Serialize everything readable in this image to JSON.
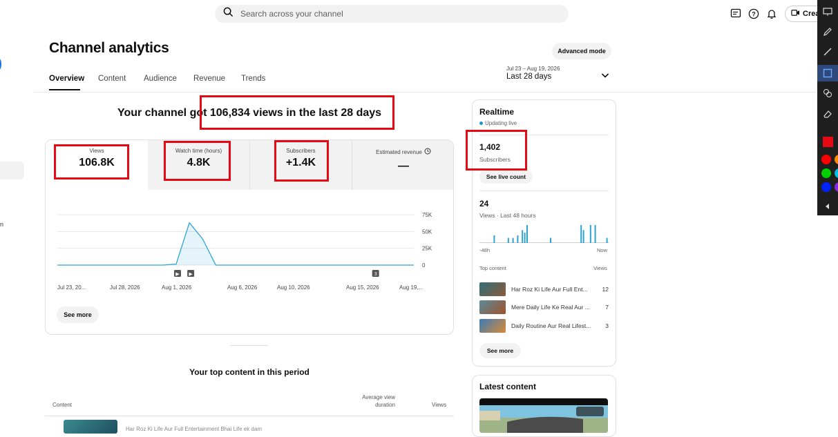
{
  "search": {
    "placeholder": "Search across your channel"
  },
  "header": {
    "create_label": "Create"
  },
  "page": {
    "title": "Channel analytics",
    "advanced_mode": "Advanced mode",
    "tabs": [
      "Overview",
      "Content",
      "Audience",
      "Revenue",
      "Trends"
    ],
    "date_range_small": "Jul 23 – Aug 19, 2026",
    "date_range_label": "Last 28 days"
  },
  "headline": "Your channel got 106,834 views in the last 28 days",
  "metrics": [
    {
      "label": "Views",
      "value": "106.8K"
    },
    {
      "label": "Watch time (hours)",
      "value": "4.8K"
    },
    {
      "label": "Subscribers",
      "value": "+1.4K"
    },
    {
      "label": "Estimated revenue",
      "value": "—"
    }
  ],
  "chart_data": {
    "type": "area",
    "x": [
      "Jul 23, 20...",
      "Jul 28, 2026",
      "Aug 1, 2026",
      "Aug 6, 2026",
      "Aug 10, 2026",
      "Aug 15, 2026",
      "Aug 19,..."
    ],
    "y_ticks": [
      "75K",
      "50K",
      "25K",
      "0"
    ],
    "ylim": [
      0,
      75000
    ],
    "series": [
      {
        "values": [
          0,
          0,
          0,
          0,
          0,
          0,
          0,
          0,
          0,
          1500,
          63000,
          39000,
          0,
          0,
          0,
          0,
          0,
          0,
          0,
          0,
          0,
          0,
          0,
          0,
          0,
          0,
          0,
          0
        ]
      }
    ],
    "markers": [
      {
        "label": "▶",
        "day": 9
      },
      {
        "label": "▶",
        "day": 10
      },
      {
        "label": "3",
        "day": 24
      }
    ],
    "color": "#2ba4d4",
    "grid": true
  },
  "main_see_more": "See more",
  "top_content": {
    "title": "Your top content in this period",
    "col_content": "Content",
    "col_avd_1": "Average view",
    "col_avd_2": "duration",
    "col_views": "Views",
    "first_row": "Har Roz Ki Life Aur Full Entertainment Bhai Life ek dam"
  },
  "realtime": {
    "title": "Realtime",
    "live_text": "Updating live",
    "subs_value": "1,402",
    "subs_label": "Subscribers",
    "live_count_button": "See live count",
    "views_value": "24",
    "views_label": "Views · Last 48 hours",
    "axis_start": "-48h",
    "axis_end": "Now",
    "bars": [
      0,
      0,
      0,
      0,
      0,
      0,
      3,
      0,
      0,
      0,
      0,
      0,
      2,
      0,
      2,
      0,
      3,
      0,
      5,
      4,
      7,
      0,
      0,
      0,
      0,
      0,
      0,
      0,
      0,
      0,
      2,
      0,
      0,
      0,
      0,
      0,
      0,
      0,
      0,
      0,
      0,
      0,
      0,
      7,
      5,
      0,
      0,
      7,
      0,
      7,
      0,
      0,
      0,
      0,
      2
    ],
    "top_content_label": "Top content",
    "views_col": "Views",
    "items": [
      {
        "title": "Har Roz Ki Life Aur Full Ent...",
        "views": "12"
      },
      {
        "title": "Mere Daily Life Ke Real Aur ...",
        "views": "7"
      },
      {
        "title": "Daily Routine Aur Real Lifest...",
        "views": "3"
      }
    ],
    "see_more": "See more"
  },
  "latest": {
    "title": "Latest content"
  },
  "colors": {
    "accent": "#2ba4d4",
    "annotation": "#e50914"
  }
}
